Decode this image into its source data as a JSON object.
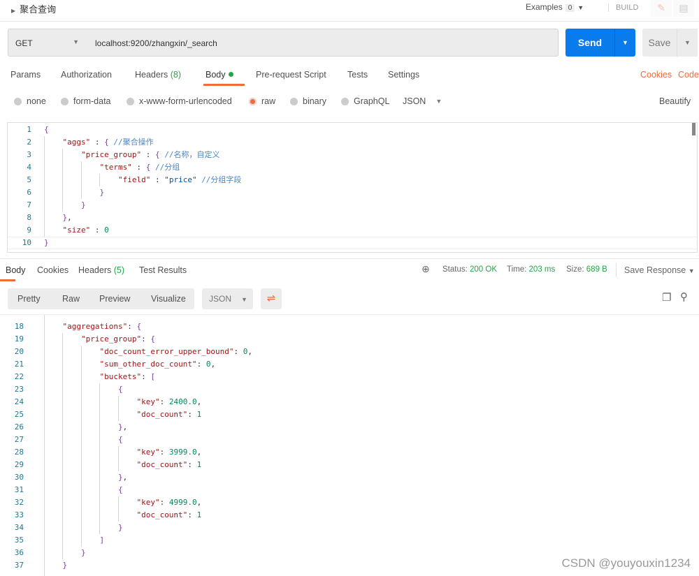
{
  "header": {
    "title": "聚合查询",
    "examples_label": "Examples",
    "examples_count": "0",
    "build_label": "BUILD"
  },
  "request": {
    "method": "GET",
    "url": "localhost:9200/zhangxin/_search",
    "send_label": "Send",
    "save_label": "Save"
  },
  "tabs": [
    {
      "label": "Params"
    },
    {
      "label": "Authorization"
    },
    {
      "label": "Headers",
      "count": "(8)"
    },
    {
      "label": "Body"
    },
    {
      "label": "Pre-request Script"
    },
    {
      "label": "Tests"
    },
    {
      "label": "Settings"
    }
  ],
  "tab_links": {
    "cookies": "Cookies",
    "code": "Code"
  },
  "body_types": {
    "none": "none",
    "form_data": "form-data",
    "urlencoded": "x-www-form-urlencoded",
    "raw": "raw",
    "binary": "binary",
    "graphql": "GraphQL",
    "format": "JSON",
    "beautify": "Beautify",
    "selected": "raw"
  },
  "request_body": [
    "{",
    "    \"aggs\" : { //聚合操作",
    "        \"price_group\" : { //名称，自定义",
    "            \"terms\" : { //分组",
    "                \"field\" : \"price\" //分组字段",
    "            }",
    "        }",
    "    },",
    "    \"size\" : 0",
    "}"
  ],
  "response": {
    "tabs": [
      {
        "label": "Body"
      },
      {
        "label": "Cookies"
      },
      {
        "label": "Headers",
        "count": "(5)"
      },
      {
        "label": "Test Results"
      }
    ],
    "status_label": "Status:",
    "status": "200 OK",
    "time_label": "Time:",
    "time": "203 ms",
    "size_label": "Size:",
    "size": "689 B",
    "save_response": "Save Response",
    "views": [
      "Pretty",
      "Raw",
      "Preview",
      "Visualize"
    ],
    "format": "JSON",
    "first_line": 18,
    "body": [
      "    \"aggregations\": {",
      "        \"price_group\": {",
      "            \"doc_count_error_upper_bound\": 0,",
      "            \"sum_other_doc_count\": 0,",
      "            \"buckets\": [",
      "                {",
      "                    \"key\": 2400.0,",
      "                    \"doc_count\": 1",
      "                },",
      "                {",
      "                    \"key\": 3999.0,",
      "                    \"doc_count\": 1",
      "                },",
      "                {",
      "                    \"key\": 4999.0,",
      "                    \"doc_count\": 1",
      "                }",
      "            ]",
      "        }",
      "    }"
    ]
  },
  "watermark": "CSDN @youyouxin1234",
  "colors": {
    "accent": "#f26b3a",
    "send": "#097bed",
    "success": "#26a544"
  }
}
